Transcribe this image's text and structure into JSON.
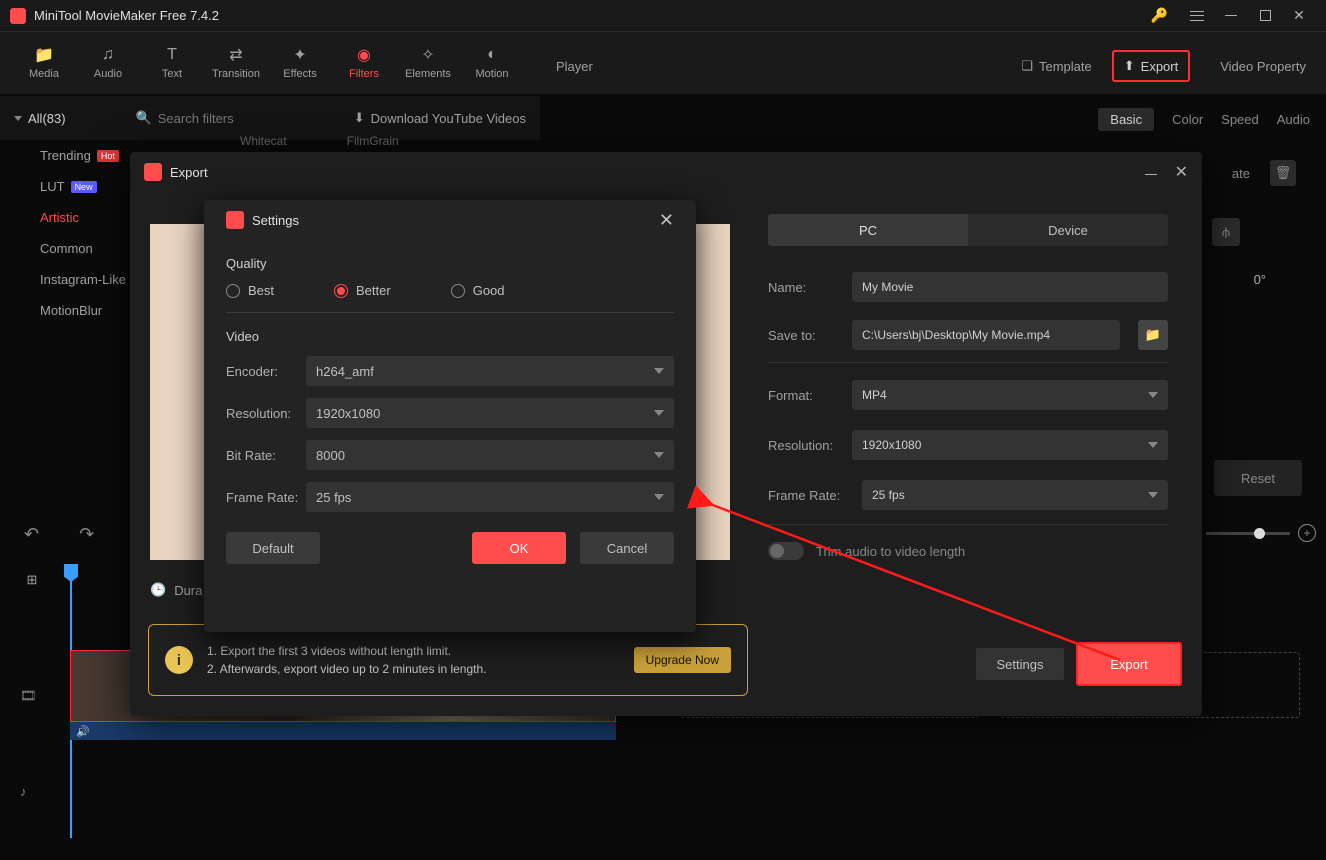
{
  "app": {
    "title": "MiniTool MovieMaker Free 7.4.2"
  },
  "toolbar": {
    "items": [
      {
        "label": "Media",
        "icon": "folder"
      },
      {
        "label": "Audio",
        "icon": "music"
      },
      {
        "label": "Text",
        "icon": "text"
      },
      {
        "label": "Transition",
        "icon": "transition"
      },
      {
        "label": "Effects",
        "icon": "sparkle"
      },
      {
        "label": "Filters",
        "icon": "filter"
      },
      {
        "label": "Elements",
        "icon": "star"
      },
      {
        "label": "Motion",
        "icon": "motion"
      }
    ],
    "active_index": 5
  },
  "player_bar": {
    "player": "Player",
    "template": "Template",
    "export": "Export",
    "video_property": "Video Property"
  },
  "subheader": {
    "all": "All(83)",
    "search_placeholder": "Search filters",
    "download_yt": "Download YouTube Videos"
  },
  "right_panel": {
    "tabs": [
      "Basic",
      "Color",
      "Speed",
      "Audio"
    ],
    "active_tab": 0,
    "rotate_label": "ate",
    "rotation": "0°",
    "reset": "Reset"
  },
  "sidebar": {
    "categories": [
      {
        "label": "Trending",
        "badge": "Hot",
        "badge_class": "hot"
      },
      {
        "label": "LUT",
        "badge": "New",
        "badge_class": "new"
      },
      {
        "label": "Artistic",
        "active": true
      },
      {
        "label": "Common"
      },
      {
        "label": "Instagram-Like"
      },
      {
        "label": "MotionBlur"
      }
    ],
    "thumb_names": [
      "Whitecat",
      "FilmGrain"
    ]
  },
  "timeline": {
    "duration_label": "Dura"
  },
  "export_dialog": {
    "title": "Export",
    "tabs": {
      "pc": "PC",
      "device": "Device"
    },
    "name_label": "Name:",
    "name_value": "My Movie",
    "saveto_label": "Save to:",
    "saveto_value": "C:\\Users\\bj\\Desktop\\My Movie.mp4",
    "format_label": "Format:",
    "format_value": "MP4",
    "resolution_label": "Resolution:",
    "resolution_value": "1920x1080",
    "framerate_label": "Frame Rate:",
    "framerate_value": "25 fps",
    "trim_label": "Trim audio to video length",
    "settings_btn": "Settings",
    "export_btn": "Export",
    "upgrade": {
      "line1": "1. Export the first 3 videos without length limit.",
      "line2": "2. Afterwards, export video up to 2 minutes in length.",
      "button": "Upgrade Now"
    }
  },
  "settings_dialog": {
    "title": "Settings",
    "quality_title": "Quality",
    "quality_options": [
      "Best",
      "Better",
      "Good"
    ],
    "quality_selected": 1,
    "video_title": "Video",
    "encoder_label": "Encoder:",
    "encoder_value": "h264_amf",
    "resolution_label": "Resolution:",
    "resolution_value": "1920x1080",
    "bitrate_label": "Bit Rate:",
    "bitrate_value": "8000",
    "framerate_label": "Frame Rate:",
    "framerate_value": "25 fps",
    "default_btn": "Default",
    "ok_btn": "OK",
    "cancel_btn": "Cancel"
  }
}
